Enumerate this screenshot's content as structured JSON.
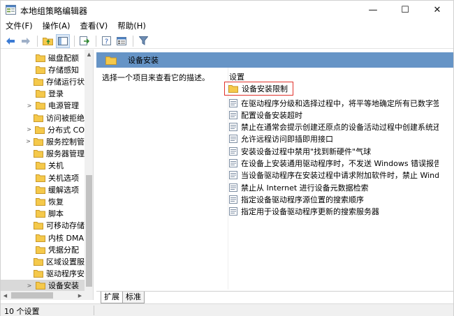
{
  "window": {
    "title": "本地组策略编辑器",
    "minimize_glyph": "—",
    "maximize_glyph": "☐",
    "close_glyph": "✕"
  },
  "menu": [
    "文件(F)",
    "操作(A)",
    "查看(V)",
    "帮助(H)"
  ],
  "toolbar": {
    "icons": [
      "back-icon",
      "forward-icon",
      "up-folder-icon",
      "show-hide-tree-icon",
      "export-list-icon",
      "help-icon",
      "properties-icon",
      "filter-icon"
    ]
  },
  "tree": {
    "items": [
      {
        "label": "磁盘配额",
        "expandable": false
      },
      {
        "label": "存储感知",
        "expandable": false
      },
      {
        "label": "存储运行状",
        "expandable": false
      },
      {
        "label": "登录",
        "expandable": false
      },
      {
        "label": "电源管理",
        "expandable": true
      },
      {
        "label": "访问被拒绝",
        "expandable": false
      },
      {
        "label": "分布式 CO",
        "expandable": true
      },
      {
        "label": "服务控制管",
        "expandable": true
      },
      {
        "label": "服务器管理",
        "expandable": false
      },
      {
        "label": "关机",
        "expandable": false
      },
      {
        "label": "关机选项",
        "expandable": false
      },
      {
        "label": "缓解选项",
        "expandable": false
      },
      {
        "label": "恢复",
        "expandable": false
      },
      {
        "label": "脚本",
        "expandable": false
      },
      {
        "label": "可移动存储",
        "expandable": false
      },
      {
        "label": "内核 DMA",
        "expandable": false
      },
      {
        "label": "凭据分配",
        "expandable": false
      },
      {
        "label": "区域设置服",
        "expandable": false
      },
      {
        "label": "驱动程序安",
        "expandable": false
      },
      {
        "label": "设备安装",
        "expandable": true,
        "selected": true
      }
    ]
  },
  "right": {
    "header": "设备安装",
    "description": "选择一个项目来查看它的描述。",
    "column": "设置",
    "folder": "设备安装限制",
    "settings": [
      "在驱动程序分级和选择过程中，将平等地确定所有已数字签...",
      "配置设备安装超时",
      "禁止在通常会提示创建还原点的设备活动过程中创建系统还...",
      "允许远程访问即插即用接口",
      "安装设备过程中禁用\"找到新硬件\"气球",
      "在设备上安装通用驱动程序时，不发送 Windows 错误报告",
      "当设备驱动程序在安装过程中请求附加软件时，禁止 Wind...",
      "禁止从 Internet 进行设备元数据检索",
      "指定设备驱动程序源位置的搜索顺序",
      "指定用于设备驱动程序更新的搜索服务器"
    ]
  },
  "tabs": [
    "扩展",
    "标准"
  ],
  "status": "10 个设置",
  "colors": {
    "header_bg": "#6694c6",
    "highlight_border": "#e0322b",
    "folder": "#f5c94b"
  }
}
